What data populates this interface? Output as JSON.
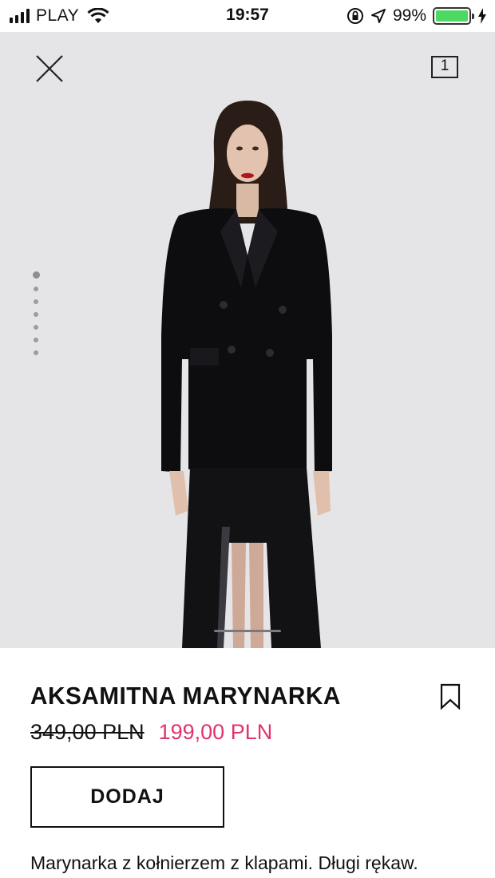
{
  "status_bar": {
    "carrier": "PLAY",
    "time": "19:57",
    "battery_percent": "99%",
    "battery_level": 0.99,
    "icons": [
      "signal-icon",
      "wifi-icon",
      "orientation-lock-icon",
      "location-icon",
      "battery-icon",
      "charging-icon"
    ]
  },
  "header": {
    "close_icon": "close-icon",
    "cart_count": "1"
  },
  "gallery": {
    "image_count": 7,
    "active_index": 0
  },
  "product": {
    "title": "AKSAMITNA MARYNARKA",
    "old_price": "349,00 PLN",
    "new_price": "199,00 PLN",
    "add_label": "DODAJ",
    "description": "Marynarka z kołnierzem z klapami. Długi rękaw. Kieszeń z klapką w dolnej części. Zapięcie"
  },
  "colors": {
    "sale_price": "#e0346a",
    "battery": "#4cd964",
    "photo_background": "#e5e4e7"
  }
}
